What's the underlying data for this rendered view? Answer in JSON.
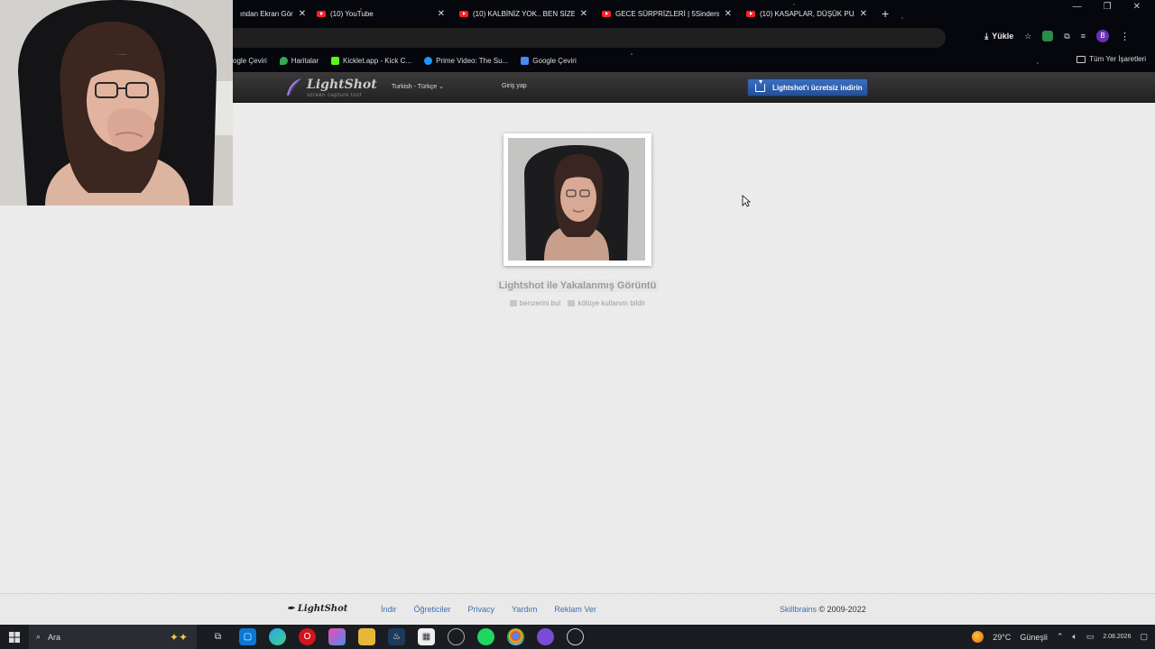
{
  "browser": {
    "tabs": [
      {
        "title": "ından Ekran Gör",
        "icon": "document-icon"
      },
      {
        "title": "(10) YouTube",
        "icon": "youtube-icon"
      },
      {
        "title": "(10) KALBİNİZ YOK.. BEN SİZE N",
        "icon": "youtube-icon"
      },
      {
        "title": "GECE SÜRPRİZLERİ | 5Sinders |",
        "icon": "youtube-icon"
      },
      {
        "title": "(10) KASAPLAR, DÜŞÜK PUANL",
        "icon": "youtube-icon"
      }
    ],
    "new_tab": "+",
    "install_label": "Yükle",
    "profile_initial": "B",
    "bookmarks": [
      {
        "label": "ogle Çeviri",
        "color": "#4a8af4"
      },
      {
        "label": "Haritalar",
        "color": "#34a853"
      },
      {
        "label": "Kicklet.app - Kick C...",
        "color": "#53fc18"
      },
      {
        "label": "Prime Video: The Su...",
        "color": "#1a98ff"
      },
      {
        "label": "Google Çeviri",
        "color": "#4a8af4"
      }
    ],
    "all_bookmarks": "Tüm Yer İşaretleri"
  },
  "lightshot": {
    "logo": "LightShot",
    "logo_sub": "screen capture tool",
    "language": "Turkish - Türkçe",
    "login": "Giriş yap",
    "download_button": "Lightshot'ı ücretsiz indirin",
    "caption": "Lightshot ile Yakalanmış Görüntü",
    "find_similar": "benzerini bul",
    "report_abuse": "kötüye kullanım bildir"
  },
  "footer": {
    "logo": "LightShot",
    "links": [
      "İndir",
      "Öğreticiler",
      "Privacy",
      "Yardım",
      "Reklam Ver"
    ],
    "brand": "Skillbrains",
    "copyright": "© 2009-2022"
  },
  "taskbar": {
    "search_placeholder": "Ara",
    "weather_temp": "29°C",
    "weather_desc": "Güneşli",
    "date": "2.08.2026"
  }
}
